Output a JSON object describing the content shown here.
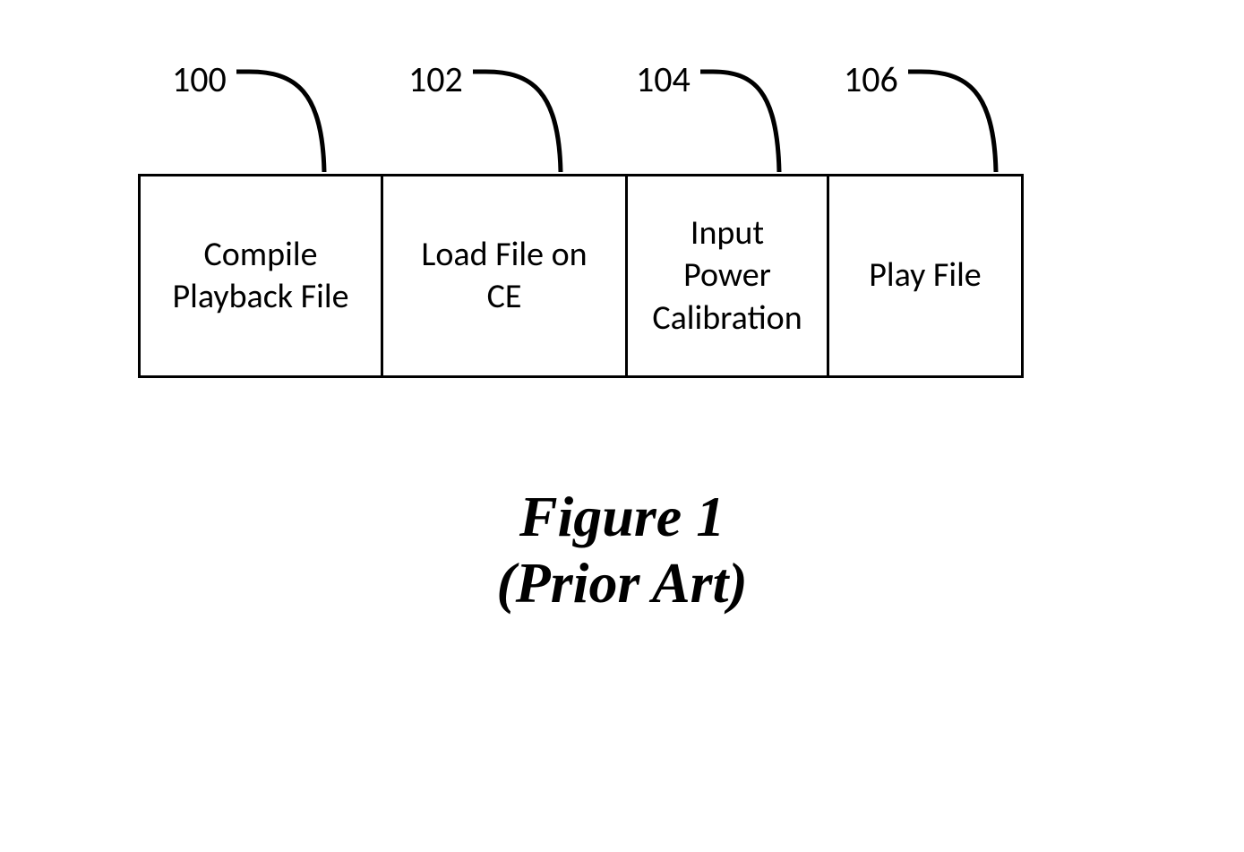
{
  "callouts": {
    "c0": "100",
    "c1": "102",
    "c2": "104",
    "c3": "106"
  },
  "boxes": {
    "b0": "Compile\nPlayback File",
    "b1": "Load File on\nCE",
    "b2": "Input\nPower\nCalibration",
    "b3": "Play File"
  },
  "caption": {
    "line1": "Figure 1",
    "line2": "(Prior Art)"
  }
}
